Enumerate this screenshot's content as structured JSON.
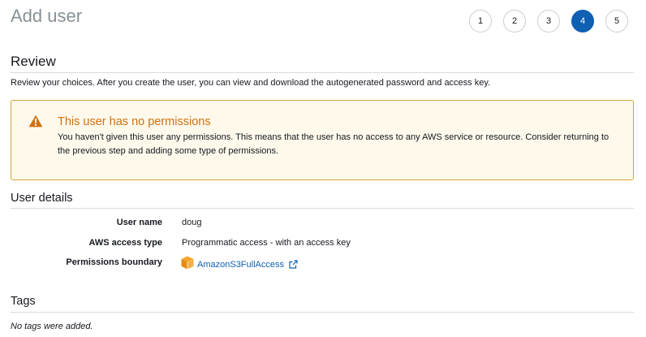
{
  "page": {
    "title": "Add user"
  },
  "wizard": {
    "steps": [
      "1",
      "2",
      "3",
      "4",
      "5"
    ],
    "active_step": "4",
    "accent_color": "#0f5fb3"
  },
  "review": {
    "heading": "Review",
    "description": "Review your choices. After you create the user, you can view and download the autogenerated password and access key."
  },
  "alert": {
    "icon": "warning-icon",
    "title": "This user has no permissions",
    "body": "You haven't given this user any permissions. This means that the user has no access to any AWS service or resource. Consider returning to the previous step and adding some type of permissions.",
    "title_color": "#d0700f",
    "background_color": "#fef9eb",
    "border_color": "#d7a53a"
  },
  "user_details": {
    "heading": "User details",
    "rows": [
      {
        "label": "User name",
        "value": "doug"
      },
      {
        "label": "AWS access type",
        "value": "Programmatic access - with an access key"
      },
      {
        "label": "Permissions boundary",
        "value": "AmazonS3FullAccess",
        "icon": "policy-cube-icon",
        "link_icon": "external-link-icon"
      }
    ]
  },
  "tags": {
    "heading": "Tags",
    "empty_text": "No tags were added."
  }
}
